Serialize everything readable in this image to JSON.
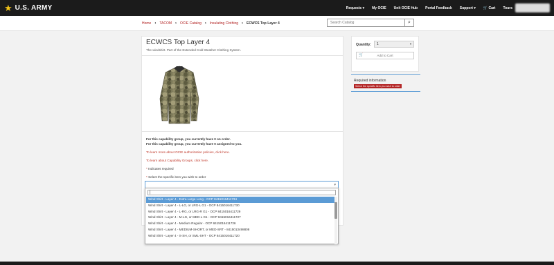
{
  "header": {
    "brand": "U.S. ARMY",
    "nav": [
      "Requests ▾",
      "My OCIE",
      "Unit OCIE Hub",
      "Portal Feedback",
      "Support ▾",
      "Cart",
      "Tours"
    ]
  },
  "breadcrumb": [
    "Home",
    "TACOM",
    "OCIE Catalog",
    "Insulating Clothing",
    "ECWCS Top Layer 4"
  ],
  "search": {
    "placeholder": "Search Catalog"
  },
  "product": {
    "title": "ECWCS Top Layer 4",
    "subtitle": "The windshirt. Part of the Extended Cold Weather Clothing System."
  },
  "info": {
    "line1": "For this capability group, you currently have 0 on order.",
    "line2": "For this capability group, you currently have 0 assigned to you.",
    "link1": "To learn more about OCIE authorization policies, click here.",
    "link2": "To learn about Capability Groups, click here.",
    "required_note": "Indicates required",
    "select_label": "Select the specific item you wish to order"
  },
  "dropdown": {
    "options": [
      "Wind Shirt - Layer 4 - Extra Large Long - OCP 8415016411734",
      "Wind Shirt - Layer 4 - L-LG, or LRG-L G1 - OCP 8415016411730",
      "Wind Shirt - Layer 4 - L-RG, or LRG-R G1 - OCP 8415016411729",
      "Wind Shirt - Layer 4 - M-LG, or MED-L G1 - OCP 8415016411727",
      "Wind Shirt - Layer 4 - Medium Regular - OCP 8415016411726",
      "Wind Shirt - Layer 4 - MEDIUM-SHORT, or MED-SRT - 8415013498808",
      "Wind Shirt - Layer 4 - S-SH, or SML-SHT - OCP 8415016411720"
    ],
    "selected_index": 0
  },
  "sidebar": {
    "quantity_label": "Quantity:",
    "quantity_value": "1",
    "add_to_cart": "Add to Cart",
    "required_info": "Required information",
    "badge": "Select the specific item you wish to order"
  },
  "colors": {
    "accent": "#b22222",
    "focus": "#5b9bd5",
    "header": "#1b1b1b",
    "star": "#f5c518"
  }
}
